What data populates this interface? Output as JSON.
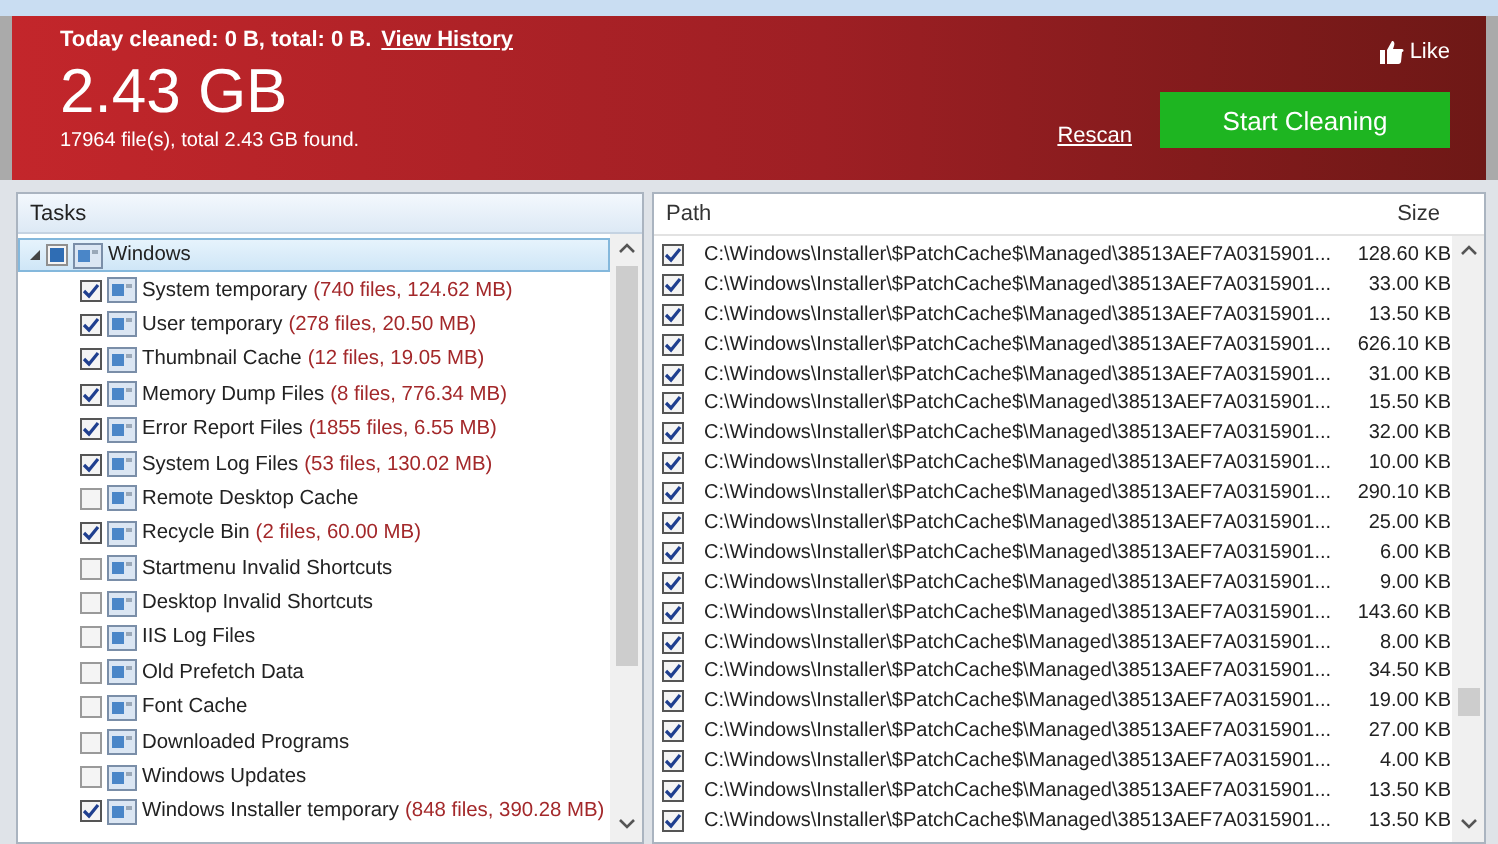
{
  "summary": {
    "today": "Today cleaned: 0 B, total: 0 B.",
    "history_link": "View History",
    "like": "Like",
    "size": "2.43 GB",
    "found": "17964 file(s), total 2.43 GB found.",
    "rescan": "Rescan",
    "start": "Start Cleaning"
  },
  "tasks": {
    "title": "Tasks",
    "tree": [
      {
        "label": "Windows",
        "mixed": true,
        "expanded": true,
        "selected": true,
        "children": [
          {
            "label": "System temporary",
            "detail": "(740 files, 124.62 MB)",
            "checked": true,
            "selected": false
          },
          {
            "label": "User temporary",
            "detail": "(278 files, 20.50 MB)",
            "checked": true,
            "selected": false
          },
          {
            "label": "Thumbnail Cache",
            "detail": "(12 files, 19.05 MB)",
            "checked": true,
            "selected": false
          },
          {
            "label": "Memory Dump Files",
            "detail": "(8 files, 776.34 MB)",
            "checked": true,
            "selected": false
          },
          {
            "label": "Error Report Files",
            "detail": "(1855 files, 6.55 MB)",
            "checked": true,
            "selected": false
          },
          {
            "label": "System Log Files",
            "detail": "(53 files, 130.02 MB)",
            "checked": true,
            "selected": false
          },
          {
            "label": "Remote Desktop Cache",
            "checked": false,
            "selected": false
          },
          {
            "label": "Recycle Bin",
            "detail": "(2 files, 60.00 MB)",
            "checked": true,
            "selected": false
          },
          {
            "label": "Startmenu Invalid Shortcuts",
            "checked": false,
            "selected": false
          },
          {
            "label": "Desktop Invalid Shortcuts",
            "checked": false,
            "selected": false
          },
          {
            "label": "IIS Log Files",
            "checked": false,
            "selected": false
          },
          {
            "label": "Old Prefetch Data",
            "checked": false,
            "selected": false
          },
          {
            "label": "Font Cache",
            "checked": false,
            "selected": false
          },
          {
            "label": "Downloaded Programs",
            "checked": false,
            "selected": false
          },
          {
            "label": "Windows Updates",
            "checked": false,
            "selected": false
          },
          {
            "label": "Windows Installer temporary",
            "detail": "(848 files, 390.28 MB)",
            "checked": true,
            "selected": false
          }
        ]
      }
    ]
  },
  "files": {
    "columns": [
      "Path",
      "Size"
    ],
    "rows": [
      {
        "checked": true,
        "path": "C:\\Windows\\Installer\\$PatchCache$\\Managed\\38513AEF7A0315901...",
        "size": "128.60 KB"
      },
      {
        "checked": true,
        "path": "C:\\Windows\\Installer\\$PatchCache$\\Managed\\38513AEF7A0315901...",
        "size": "33.00 KB"
      },
      {
        "checked": true,
        "path": "C:\\Windows\\Installer\\$PatchCache$\\Managed\\38513AEF7A0315901...",
        "size": "13.50 KB"
      },
      {
        "checked": true,
        "path": "C:\\Windows\\Installer\\$PatchCache$\\Managed\\38513AEF7A0315901...",
        "size": "626.10 KB"
      },
      {
        "checked": true,
        "path": "C:\\Windows\\Installer\\$PatchCache$\\Managed\\38513AEF7A0315901...",
        "size": "31.00 KB"
      },
      {
        "checked": true,
        "path": "C:\\Windows\\Installer\\$PatchCache$\\Managed\\38513AEF7A0315901...",
        "size": "15.50 KB"
      },
      {
        "checked": true,
        "path": "C:\\Windows\\Installer\\$PatchCache$\\Managed\\38513AEF7A0315901...",
        "size": "32.00 KB"
      },
      {
        "checked": true,
        "path": "C:\\Windows\\Installer\\$PatchCache$\\Managed\\38513AEF7A0315901...",
        "size": "10.00 KB"
      },
      {
        "checked": true,
        "path": "C:\\Windows\\Installer\\$PatchCache$\\Managed\\38513AEF7A0315901...",
        "size": "290.10 KB"
      },
      {
        "checked": true,
        "path": "C:\\Windows\\Installer\\$PatchCache$\\Managed\\38513AEF7A0315901...",
        "size": "25.00 KB"
      },
      {
        "checked": true,
        "path": "C:\\Windows\\Installer\\$PatchCache$\\Managed\\38513AEF7A0315901...",
        "size": "6.00 KB"
      },
      {
        "checked": true,
        "path": "C:\\Windows\\Installer\\$PatchCache$\\Managed\\38513AEF7A0315901...",
        "size": "9.00 KB"
      },
      {
        "checked": true,
        "path": "C:\\Windows\\Installer\\$PatchCache$\\Managed\\38513AEF7A0315901...",
        "size": "143.60 KB"
      },
      {
        "checked": true,
        "path": "C:\\Windows\\Installer\\$PatchCache$\\Managed\\38513AEF7A0315901...",
        "size": "8.00 KB"
      },
      {
        "checked": true,
        "path": "C:\\Windows\\Installer\\$PatchCache$\\Managed\\38513AEF7A0315901...",
        "size": "34.50 KB"
      },
      {
        "checked": true,
        "path": "C:\\Windows\\Installer\\$PatchCache$\\Managed\\38513AEF7A0315901...",
        "size": "19.00 KB"
      },
      {
        "checked": true,
        "path": "C:\\Windows\\Installer\\$PatchCache$\\Managed\\38513AEF7A0315901...",
        "size": "27.00 KB"
      },
      {
        "checked": true,
        "path": "C:\\Windows\\Installer\\$PatchCache$\\Managed\\38513AEF7A0315901...",
        "size": "4.00 KB"
      },
      {
        "checked": true,
        "path": "C:\\Windows\\Installer\\$PatchCache$\\Managed\\38513AEF7A0315901...",
        "size": "13.50 KB"
      },
      {
        "checked": true,
        "path": "C:\\Windows\\Installer\\$PatchCache$\\Managed\\38513AEF7A0315901...",
        "size": "13.50 KB"
      }
    ]
  }
}
